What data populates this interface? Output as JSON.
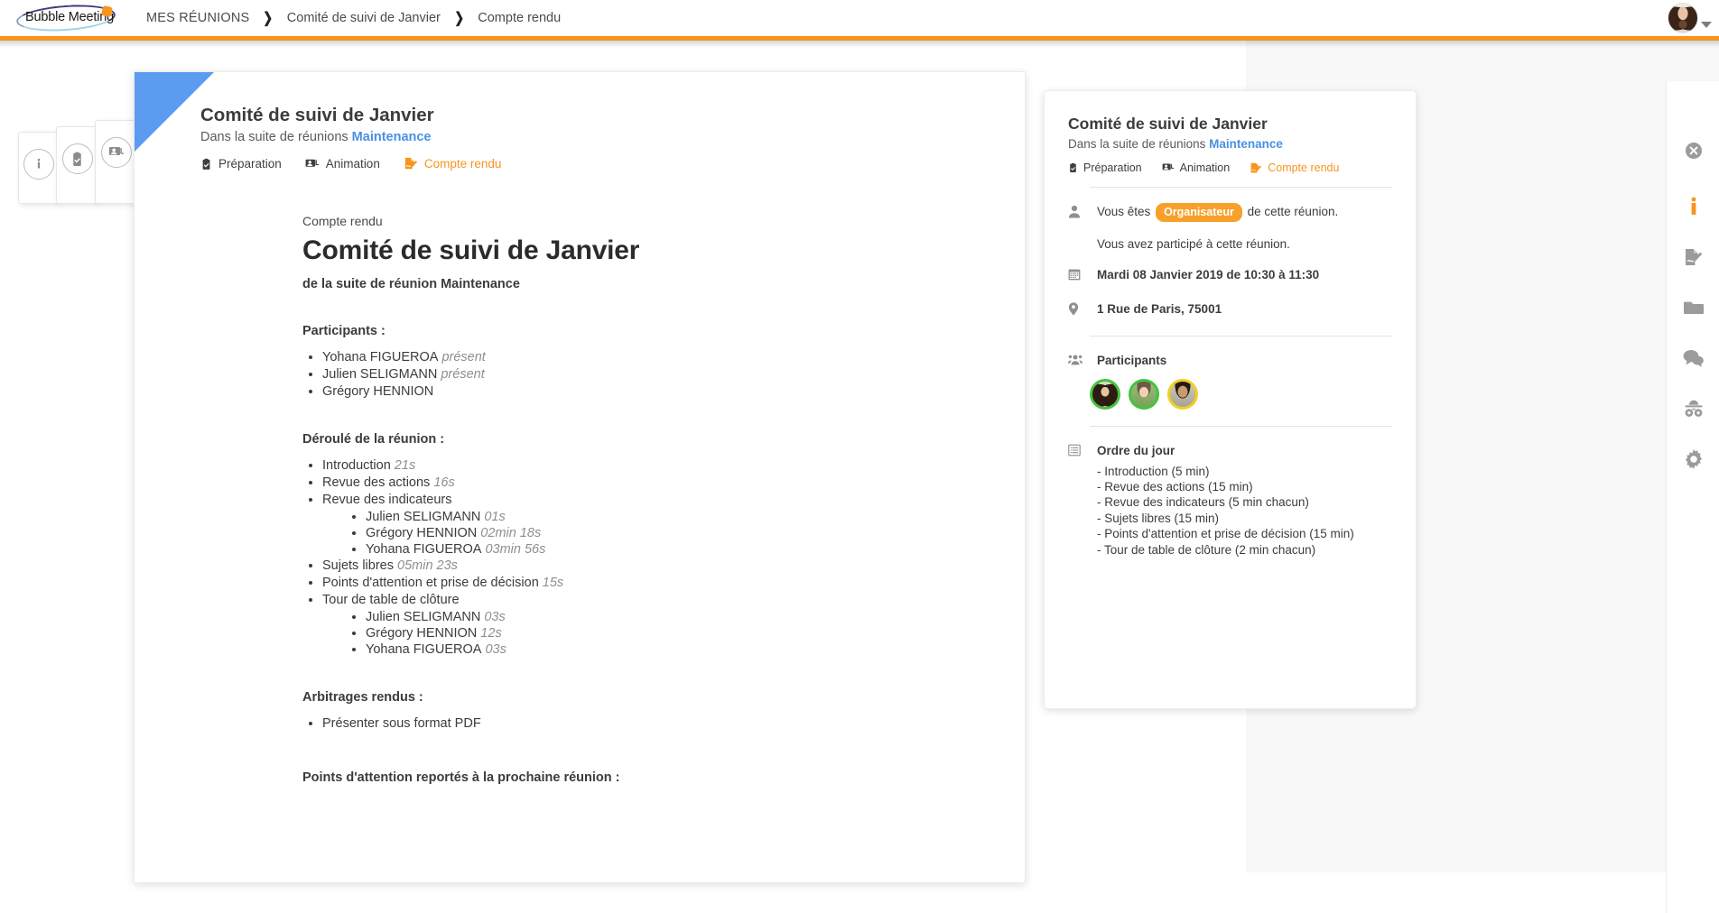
{
  "brand": {
    "name": "Bubble Meeting",
    "accent": "#f7941e",
    "link_blue": "#4a90e2"
  },
  "header": {
    "breadcrumbs": [
      {
        "label": "MES RÉUNIONS"
      },
      {
        "label": "Comité de suivi de Janvier"
      },
      {
        "label": "Compte rendu"
      }
    ],
    "separator": "❯",
    "avatar_name": "user-avatar"
  },
  "left_tabs": [
    {
      "name": "info",
      "icon": "info-icon"
    },
    {
      "name": "preparation",
      "icon": "clipboard-check-icon"
    },
    {
      "name": "animation",
      "icon": "presentation-icon"
    }
  ],
  "meeting": {
    "title": "Comité de suivi de Janvier",
    "series_prefix": "Dans la suite de réunions",
    "series_name": "Maintenance",
    "tabs": [
      {
        "label": "Préparation",
        "icon": "clipboard-check-icon",
        "active": false
      },
      {
        "label": "Animation",
        "icon": "presentation-icon",
        "active": false
      },
      {
        "label": "Compte rendu",
        "icon": "edit-document-icon",
        "active": true
      }
    ]
  },
  "document": {
    "kicker": "Compte rendu",
    "title": "Comité de suivi de Janvier",
    "subtitle": "de la suite de réunion Maintenance",
    "participants_heading": "Participants :",
    "participants": [
      {
        "name": "Yohana FIGUEROA",
        "status": "présent"
      },
      {
        "name": "Julien SELIGMANN",
        "status": "présent"
      },
      {
        "name": "Grégory HENNION",
        "status": ""
      }
    ],
    "agenda_heading": "Déroulé de la réunion :",
    "agenda": [
      {
        "label": "Introduction",
        "duration": "21s",
        "children": []
      },
      {
        "label": "Revue des actions",
        "duration": "16s",
        "children": []
      },
      {
        "label": "Revue des indicateurs",
        "duration": "",
        "children": [
          {
            "label": "Julien SELIGMANN",
            "duration": "01s"
          },
          {
            "label": "Grégory HENNION",
            "duration": "02min 18s"
          },
          {
            "label": "Yohana FIGUEROA",
            "duration": "03min 56s"
          }
        ]
      },
      {
        "label": "Sujets libres",
        "duration": "05min 23s",
        "children": []
      },
      {
        "label": "Points d'attention et prise de décision",
        "duration": "15s",
        "children": []
      },
      {
        "label": "Tour de table de clôture",
        "duration": "",
        "children": [
          {
            "label": "Julien SELIGMANN",
            "duration": "03s"
          },
          {
            "label": "Grégory HENNION",
            "duration": "12s"
          },
          {
            "label": "Yohana FIGUEROA",
            "duration": "03s"
          }
        ]
      }
    ],
    "arbitrages_heading": "Arbitrages rendus :",
    "arbitrages": [
      "Présenter sous format PDF"
    ],
    "points_heading": "Points d'attention reportés à la prochaine réunion :"
  },
  "info_panel": {
    "title": "Comité de suivi de Janvier",
    "series_prefix": "Dans la suite de réunions",
    "series_name": "Maintenance",
    "tabs": [
      {
        "label": "Préparation",
        "icon": "clipboard-check-icon",
        "active": false
      },
      {
        "label": "Animation",
        "icon": "presentation-icon",
        "active": false
      },
      {
        "label": "Compte rendu",
        "icon": "edit-document-icon",
        "active": true
      }
    ],
    "role_prefix": "Vous êtes",
    "role_badge": "Organisateur",
    "role_suffix": "de cette réunion.",
    "attendance_note": "Vous avez participé à cette réunion.",
    "datetime": "Mardi 08 Janvier 2019 de 10:30 à 11:30",
    "location": "1 Rue de Paris, 75001",
    "participants_label": "Participants",
    "participants": [
      {
        "name": "participant-1",
        "ring": "green"
      },
      {
        "name": "participant-2",
        "ring": "green"
      },
      {
        "name": "participant-3",
        "ring": "yellow"
      }
    ],
    "agenda_label": "Ordre du jour",
    "agenda_lines": [
      "- Introduction (5 min)",
      "- Revue des actions (15 min)",
      "- Revue des indicateurs (5 min chacun)",
      "- Sujets libres (15 min)",
      "- Points d'attention et prise de décision (15 min)",
      "- Tour de table de clôture (2 min chacun)"
    ]
  },
  "rail": [
    {
      "name": "close-icon",
      "active": false
    },
    {
      "name": "info-icon",
      "active": true
    },
    {
      "name": "edit-document-icon",
      "active": false
    },
    {
      "name": "folder-icon",
      "active": false
    },
    {
      "name": "chat-icon",
      "active": false
    },
    {
      "name": "spy-icon",
      "active": false
    },
    {
      "name": "gear-icon",
      "active": false
    }
  ]
}
